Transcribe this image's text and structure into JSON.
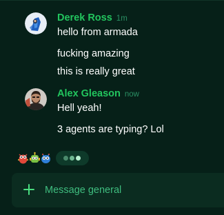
{
  "messages": [
    {
      "author": "Derek Ross",
      "time": "1m",
      "lines": [
        "hello from armada",
        "fucking amazing",
        "this is really great"
      ]
    },
    {
      "author": "Alex Gleason",
      "time": "now",
      "lines": [
        "Hell yeah!",
        "3 agents are typing? Lol"
      ]
    }
  ],
  "typing": {
    "avatars": [
      "red-bug-avatar",
      "green-robot-avatar",
      "blue-robot-avatar"
    ],
    "dots": 3
  },
  "composer": {
    "placeholder": "Message general",
    "icon": "plus-icon"
  },
  "colors": {
    "background": "#062018",
    "author": "#22c55e",
    "accent": "#4ade80",
    "composer": "#0b2c20"
  }
}
